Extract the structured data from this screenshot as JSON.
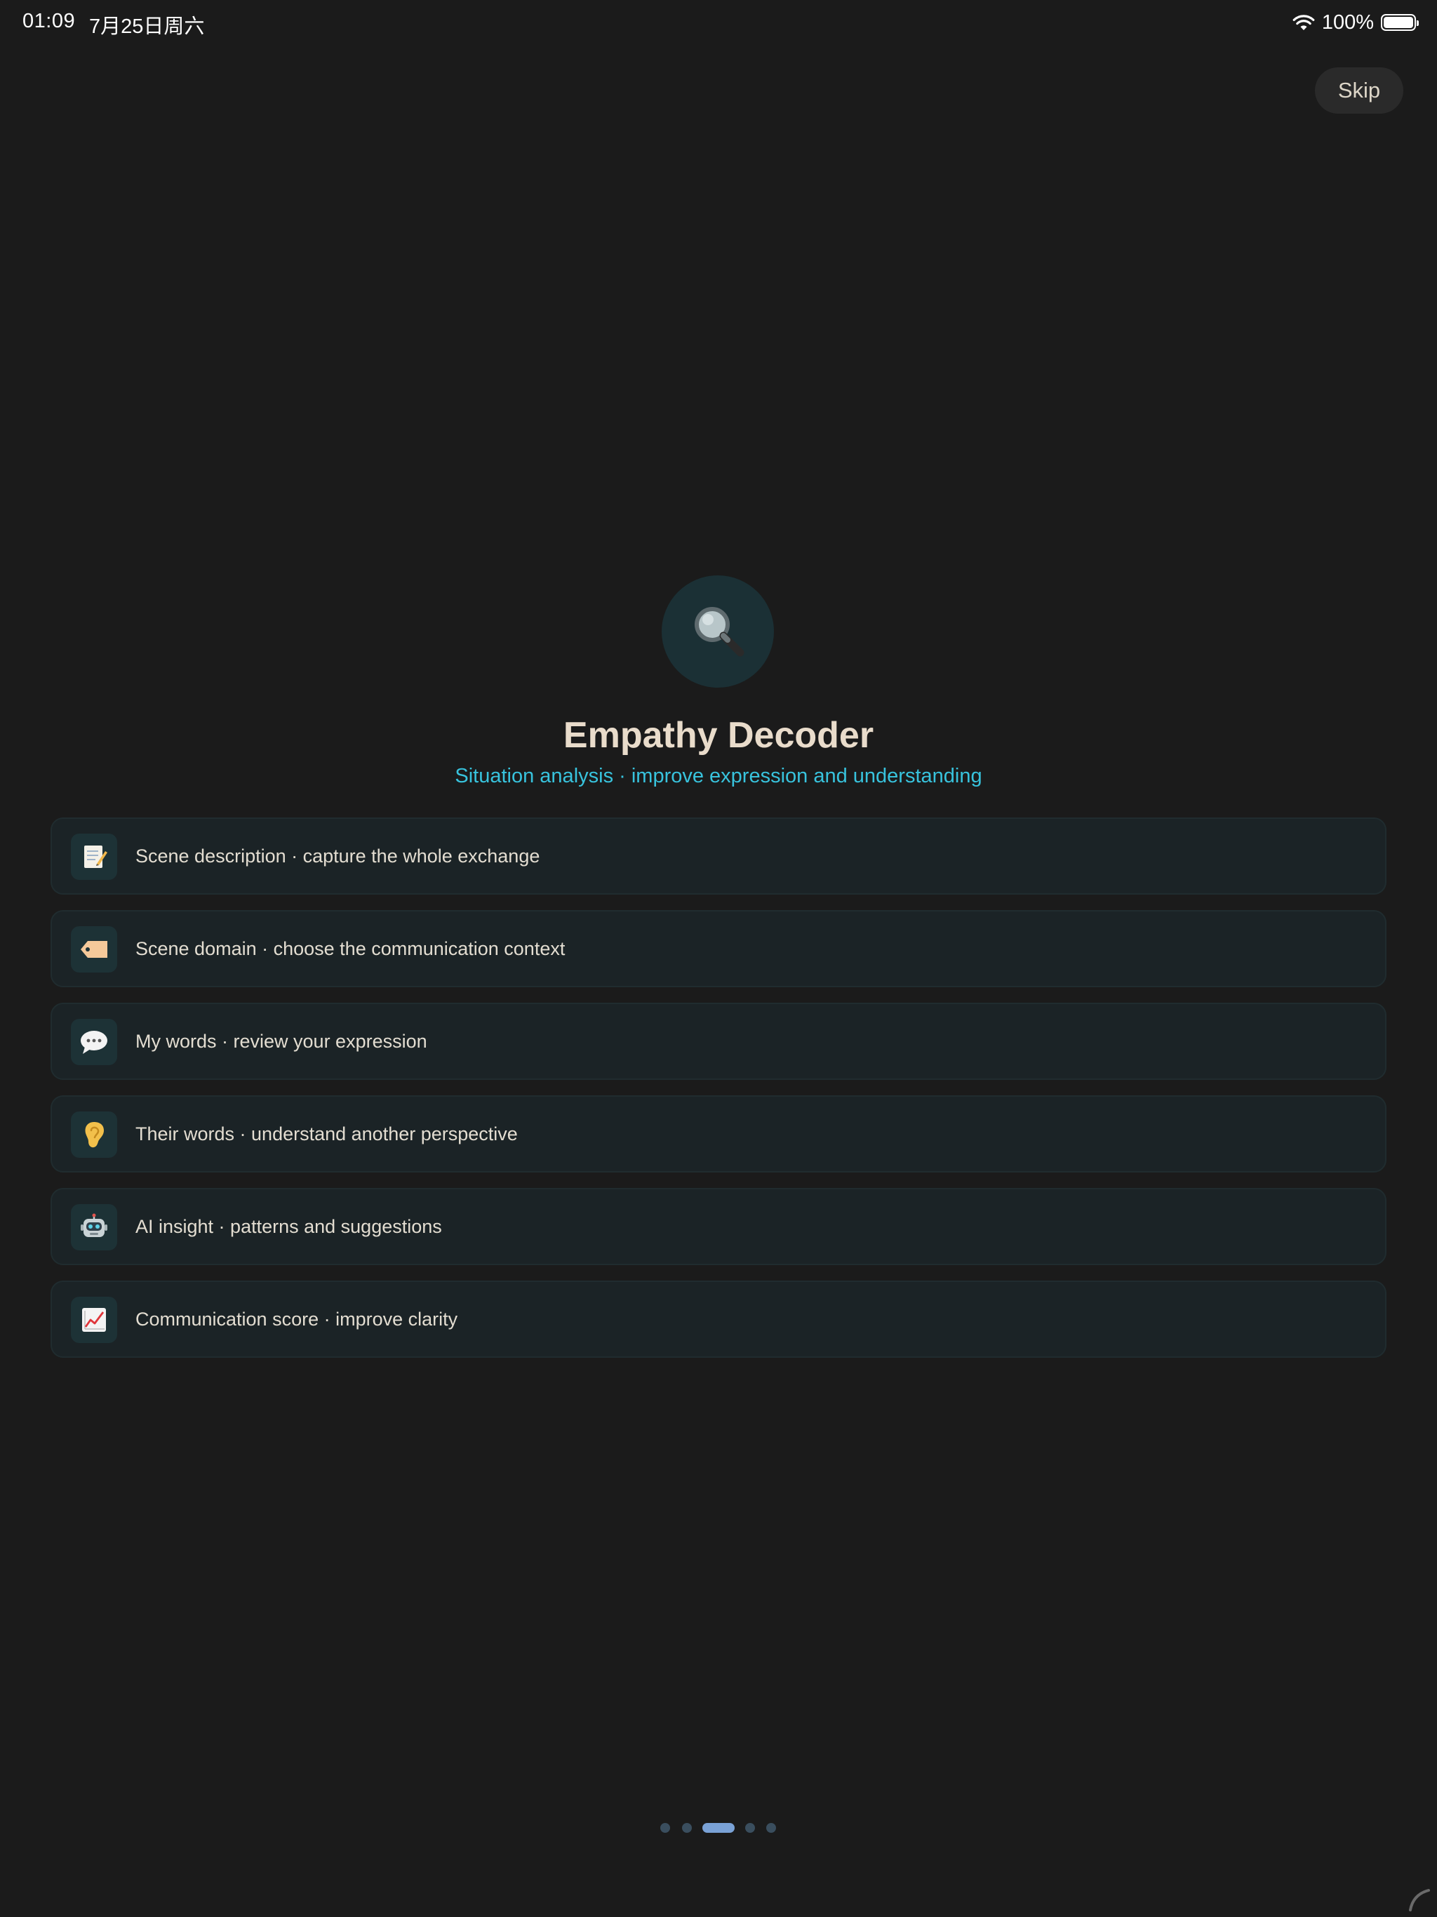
{
  "status_bar": {
    "time": "01:09",
    "date": "7月25日周六",
    "battery": "100%",
    "wifi_icon": "wifi-icon",
    "battery_icon": "battery-icon"
  },
  "skip_label": "Skip",
  "hero": {
    "icon": "magnifying-glass-icon",
    "title": "Empathy Decoder",
    "subtitle": "Situation analysis · improve expression and understanding"
  },
  "features": [
    {
      "icon": "memo-icon",
      "label": "Scene description · capture the whole exchange"
    },
    {
      "icon": "tag-icon",
      "label": "Scene domain · choose the communication context"
    },
    {
      "icon": "speech-bubble-icon",
      "label": "My words · review your expression"
    },
    {
      "icon": "ear-icon",
      "label": "Their words · understand another perspective"
    },
    {
      "icon": "robot-icon",
      "label": "AI insight · patterns and suggestions"
    },
    {
      "icon": "chart-increasing-icon",
      "label": "Communication score · improve clarity"
    }
  ],
  "pagination": {
    "total": 5,
    "current": 3
  },
  "colors": {
    "background": "#1b1b1b",
    "title": "#e9dccb",
    "subtitle_accent": "#38c3dd",
    "card_background": "#1b2326",
    "dot_active": "#7aa2d6",
    "dot_inactive": "#3a4e5e"
  }
}
